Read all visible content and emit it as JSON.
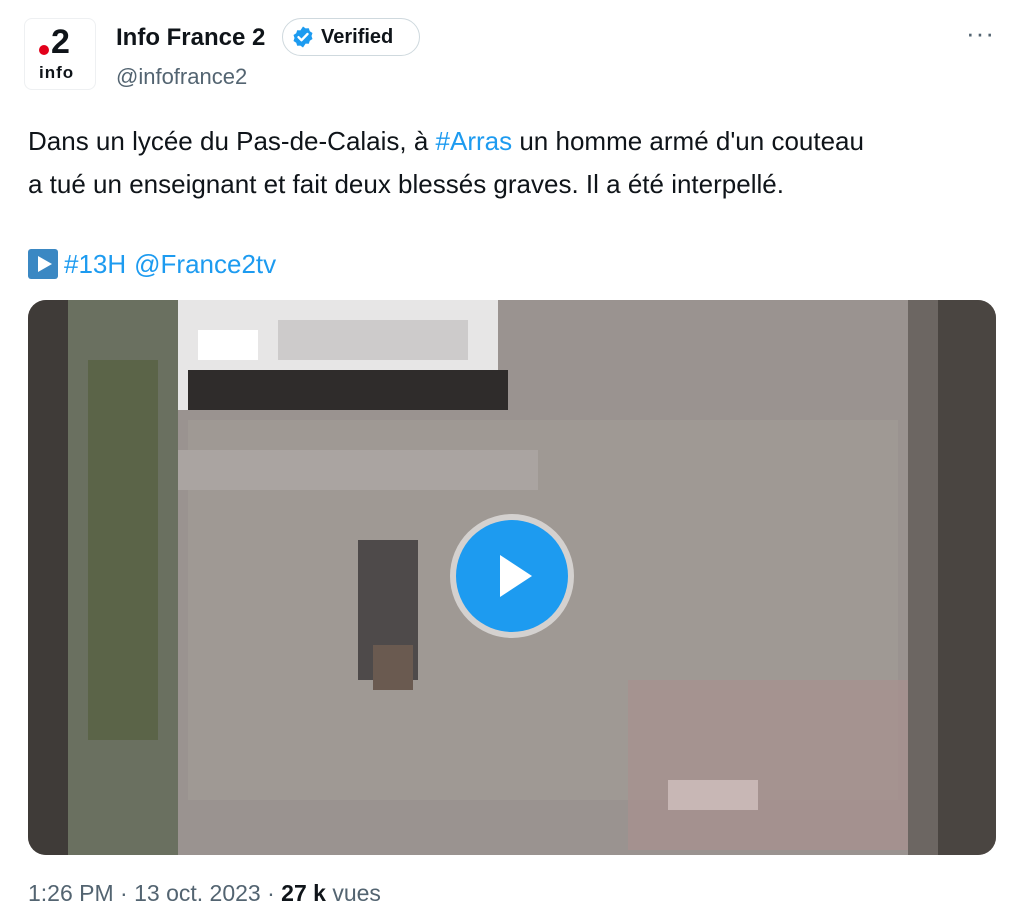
{
  "author": {
    "name": "Info France 2",
    "handle": "@infofrance2",
    "verified_label": "Verified",
    "avatar_number": "2",
    "avatar_sub": "info"
  },
  "tweet": {
    "line1_before": "Dans un lycée du Pas-de-Calais, à ",
    "line1_hashtag": "#Arras",
    "line1_after": " un homme armé d'un couteau",
    "line2": "a tué un enseignant et fait deux blessés graves. Il a été interpellé.",
    "tag_hashtag": "#13H",
    "tag_mention": "@France2tv",
    "emoji": "play-button-emoji"
  },
  "media": {
    "type": "video",
    "description_icon": "play-icon"
  },
  "meta": {
    "time": "1:26 PM",
    "separator": " · ",
    "date": "13 oct. 2023",
    "views_count": "27 k",
    "views_label": "vues"
  },
  "more_label": "···",
  "colors": {
    "accent": "#1d9bf0",
    "text": "#0f1419",
    "muted": "#536471",
    "brand_red": "#e2001a"
  }
}
